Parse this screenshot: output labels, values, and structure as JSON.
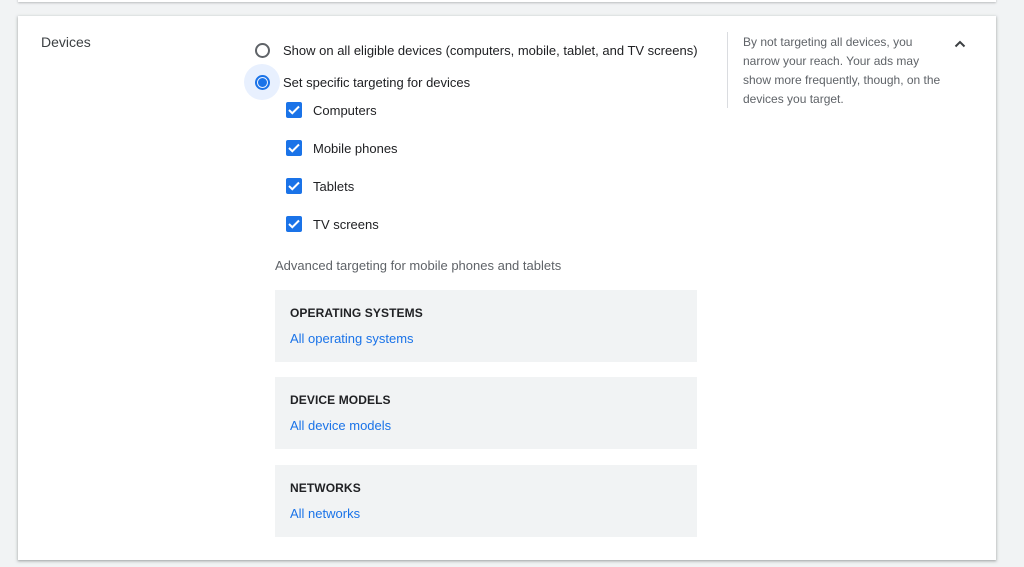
{
  "section": {
    "title": "Devices"
  },
  "options": {
    "all_devices_label": "Show on all eligible devices (computers, mobile, tablet, and TV screens)",
    "specific_label": "Set specific targeting for devices",
    "selected": "specific"
  },
  "devices": [
    {
      "label": "Computers",
      "checked": true
    },
    {
      "label": "Mobile phones",
      "checked": true
    },
    {
      "label": "Tablets",
      "checked": true
    },
    {
      "label": "TV screens",
      "checked": true
    }
  ],
  "advanced": {
    "label": "Advanced targeting for mobile phones and tablets",
    "panels": [
      {
        "title": "OPERATING SYSTEMS",
        "link": "All operating systems"
      },
      {
        "title": "DEVICE MODELS",
        "link": "All device models"
      },
      {
        "title": "NETWORKS",
        "link": "All networks"
      }
    ]
  },
  "help": {
    "text": "By not targeting all devices, you narrow your reach. Your ads may show more frequently, though, on the devices you target."
  },
  "icons": {
    "collapse": "chevron-up-icon",
    "check": "check-icon"
  },
  "colors": {
    "accent": "#1a73e8",
    "selected_bg": "#e8f0fe",
    "panel_bg": "#f1f3f4"
  }
}
